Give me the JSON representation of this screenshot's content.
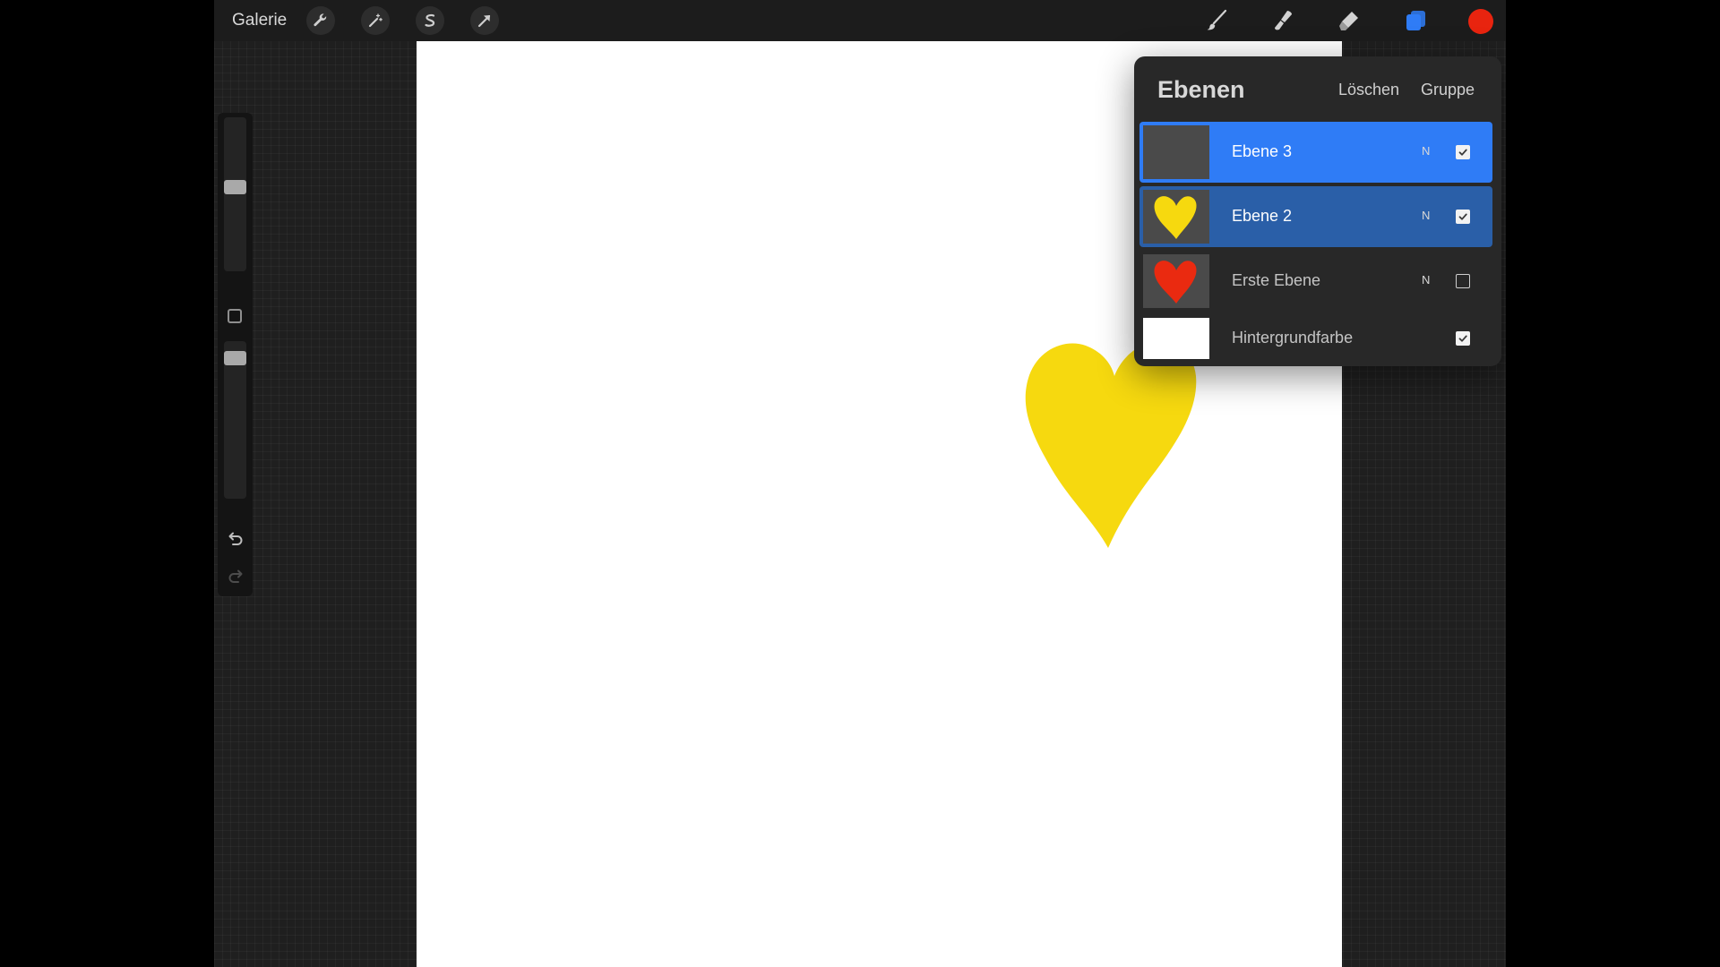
{
  "topbar": {
    "gallery_label": "Galerie",
    "left_tools": [
      "wrench-icon",
      "magic-wand-icon",
      "selection-s-icon",
      "transform-arrow-icon"
    ],
    "right_tools": [
      "brush-icon",
      "smudge-icon",
      "eraser-icon",
      "layers-icon"
    ],
    "active_color": "#e8240f",
    "accent_color": "#2f7cf6"
  },
  "sidebar": {
    "brush_size_level": 0.55,
    "opacity_level": 0.93
  },
  "canvas": {
    "background": "#ffffff",
    "visible_heart_color": "#f6d90f"
  },
  "layers_panel": {
    "title": "Ebenen",
    "delete_label": "Löschen",
    "group_label": "Gruppe",
    "layers": [
      {
        "name": "Ebene 3",
        "mode": "N",
        "visible": true,
        "thumbnail": "empty",
        "state": "selected"
      },
      {
        "name": "Ebene 2",
        "mode": "N",
        "visible": true,
        "thumbnail": "yellow-heart",
        "thumb_color": "#f6d90f",
        "state": "secondary-selected"
      },
      {
        "name": "Erste Ebene",
        "mode": "N",
        "visible": false,
        "thumbnail": "red-heart",
        "thumb_color": "#ea2a10",
        "state": "normal"
      },
      {
        "name": "Hintergrundfarbe",
        "mode": "",
        "visible": true,
        "thumbnail": "white",
        "state": "normal"
      }
    ]
  }
}
